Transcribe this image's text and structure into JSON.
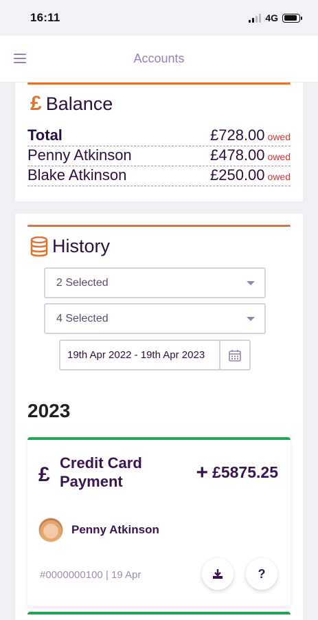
{
  "status_bar": {
    "time": "16:11",
    "network": "4G"
  },
  "app_bar": {
    "title": "Accounts"
  },
  "balance": {
    "symbol": "£",
    "title": "Balance",
    "rows": [
      {
        "name": "Total",
        "amount": "£728.00",
        "status": "owed"
      },
      {
        "name": "Penny Atkinson",
        "amount": "£478.00",
        "status": "owed"
      },
      {
        "name": "Blake Atkinson",
        "amount": "£250.00",
        "status": "owed"
      }
    ]
  },
  "history": {
    "title": "History",
    "filter1": "2 Selected",
    "filter2": "4 Selected",
    "date_range": "19th Apr 2022 - 19th Apr 2023",
    "year": "2023",
    "transaction": {
      "symbol": "£",
      "title": "Credit Card Payment",
      "amount_sign": "+",
      "amount": "£5875.25",
      "person": "Penny Atkinson",
      "reference": "#0000000100 | 19 Apr",
      "help_label": "?"
    }
  },
  "colors": {
    "accent": "#e07331",
    "brand": "#3a1450",
    "owed": "#d3332f",
    "success": "#23a35a"
  },
  "icons": [
    "menu-icon",
    "database-icon",
    "calendar-icon",
    "download-icon",
    "plus-icon",
    "caret-down-icon"
  ]
}
